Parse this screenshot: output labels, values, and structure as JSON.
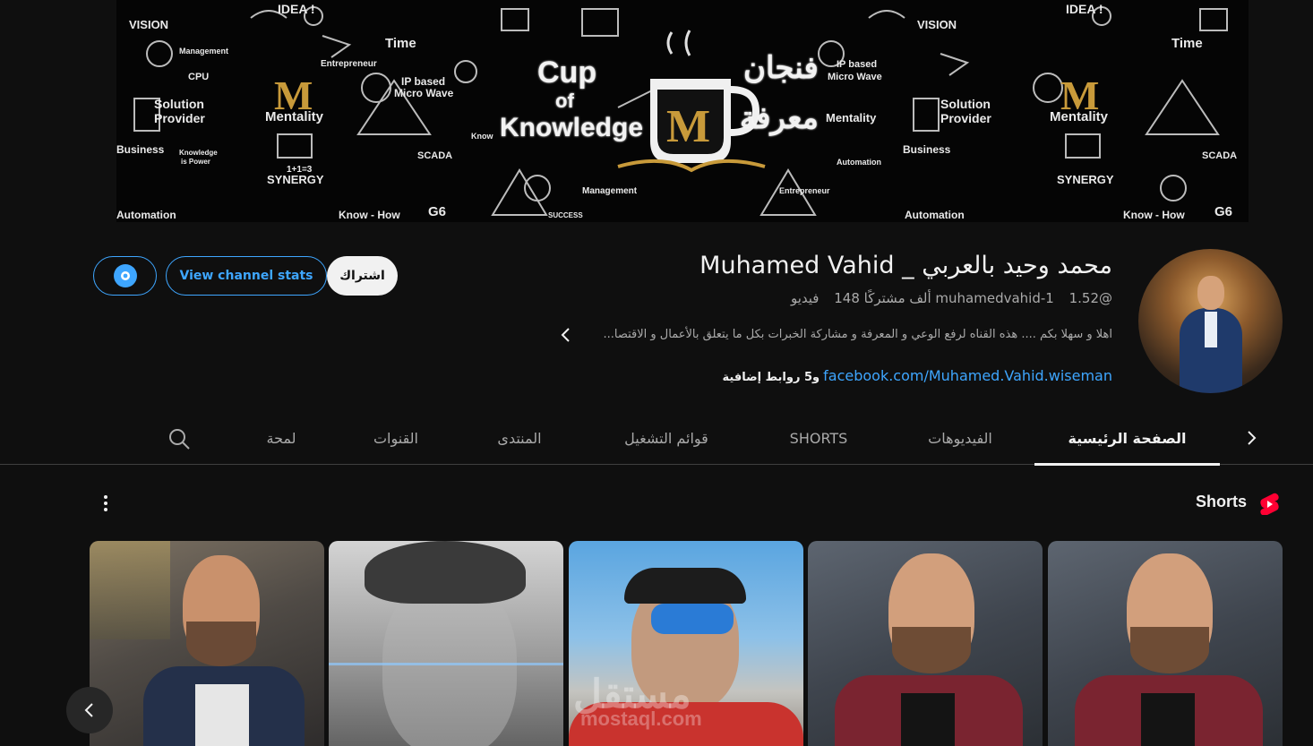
{
  "banner": {
    "center_title_lines": [
      "Cup",
      "of",
      "Knowledge"
    ],
    "arabic_lines": [
      "فنجان",
      "معرفة"
    ],
    "logo_letter": "M",
    "doodle_words": [
      "VISION",
      "IDEA !",
      "Time",
      "Management",
      "Entrepreneur",
      "CPU",
      "IP based",
      "Micro Wave",
      "Solution",
      "Provider",
      "Mentality",
      "Business",
      "Knowledge",
      "is Power",
      "1+1=3",
      "SYNERGY",
      "SCADA",
      "G6",
      "Automation",
      "Know - How",
      "SUCCESS",
      "Know",
      "Management"
    ]
  },
  "channel": {
    "title": "Muhamed Vahid _ محمد وحيد بالعربي",
    "handle": "@muhamedvahid-1",
    "subscribers": "1.52 ألف مشتركًا",
    "videos": "148 فيديو",
    "description": "اهلا و سهلا بكم .... هذه القناه لرفع الوعي و المعرفة و مشاركة الخبرات بكل ما يتعلق بالأعمال و الاقتصا...",
    "link_text": "facebook.com/Muhamed.Vahid.wiseman",
    "more_links": "و5 روابط إضافية"
  },
  "buttons": {
    "subscribe": "اشتراك",
    "channel_stats": "View channel stats"
  },
  "tabs": [
    {
      "label": "الصفحة الرئيسية",
      "active": true
    },
    {
      "label": "الفيديوهات",
      "active": false
    },
    {
      "label": "SHORTS",
      "active": false
    },
    {
      "label": "قوائم التشغيل",
      "active": false
    },
    {
      "label": "المنتدى",
      "active": false
    },
    {
      "label": "القنوات",
      "active": false
    },
    {
      "label": "لمحة",
      "active": false
    }
  ],
  "shorts_section": {
    "title": "Shorts"
  },
  "watermark": {
    "text": "مستقل",
    "sub": "mostaql.com"
  },
  "colors": {
    "background": "#0f0f0f",
    "accent_blue": "#3ea6ff",
    "youtube_red": "#ff0033",
    "text_primary": "#f1f1f1",
    "text_secondary": "#aaaaaa"
  }
}
